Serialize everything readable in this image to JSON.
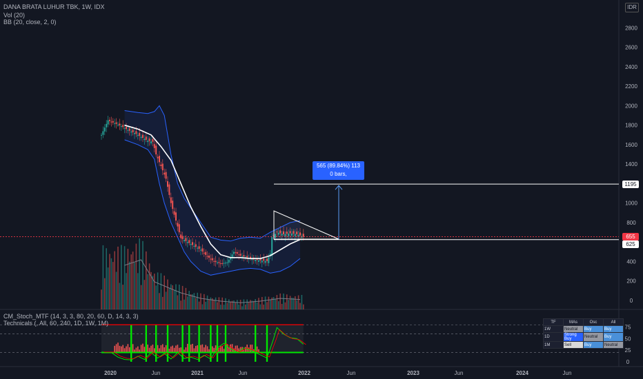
{
  "legend": {
    "main": "DANA BRATA LUHUR TBK, 1W, IDX",
    "volume": "Vol (20)",
    "bollinger": "BB (20, close, 2, 0)",
    "stoch": "CM_Stoch_MTF (14, 3, 3, 80, 20, 60, D, 14, 3, 3)",
    "technicals": "Technicals (, All, 60, 240, 1D, 1W, 1M)"
  },
  "currency": "IDR",
  "callout": {
    "line1": "565 (89.84%) 113",
    "line2": "0 bars,"
  },
  "price_tags": {
    "target": "1195",
    "last": "655",
    "support": "625"
  },
  "tech_table": {
    "headers": [
      "TF",
      "MAs",
      "Osc",
      "All"
    ],
    "rows": [
      {
        "tf": "1W",
        "mas": "Neutral",
        "osc": "Buy",
        "all": "Buy"
      },
      {
        "tf": "1D",
        "mas": "Strong Buy",
        "osc": "Neutral",
        "all": "Buy"
      },
      {
        "tf": "1M",
        "mas": "Sell",
        "osc": "Buy",
        "all": "Neutral"
      }
    ]
  },
  "colors": {
    "background": "#131722",
    "up": "#26a69a",
    "down": "#ef5350",
    "bb_band": "#2962ff",
    "basis": "#ffffff",
    "stoch_green": "#00e600",
    "stoch_red": "#ff0000",
    "stoch_grey": "#787b86"
  },
  "chart_data": {
    "type": "candlestick",
    "price_axis": {
      "ticks": [
        0,
        200,
        400,
        600,
        800,
        1000,
        1200,
        1400,
        1600,
        1800,
        2000,
        2200,
        2400,
        2600,
        2800
      ],
      "range": [
        0,
        2900
      ]
    },
    "stoch_axis": {
      "ticks": [
        0,
        25,
        50,
        75
      ],
      "range": [
        0,
        85
      ]
    },
    "time_axis": {
      "labels": [
        "2020",
        "Jun",
        "2021",
        "Jun",
        "2022",
        "Jun",
        "2023",
        "Jun",
        "2024",
        "Jun"
      ]
    },
    "levels": {
      "target": 1195,
      "last": 655,
      "support": 625
    },
    "measure": {
      "from": 630,
      "to": 1195,
      "change": 565,
      "percent": "89.84%"
    },
    "candle_path": [
      [
        0,
        1700
      ],
      [
        4,
        1850
      ],
      [
        8,
        1820
      ],
      [
        12,
        1790
      ],
      [
        16,
        1750
      ],
      [
        20,
        1720
      ],
      [
        24,
        1680
      ],
      [
        28,
        1640
      ],
      [
        31,
        1630
      ],
      [
        33,
        1500
      ],
      [
        36,
        1380
      ],
      [
        39,
        1250
      ],
      [
        42,
        1000
      ],
      [
        45,
        820
      ],
      [
        48,
        640
      ],
      [
        52,
        600
      ],
      [
        56,
        560
      ],
      [
        60,
        520
      ],
      [
        64,
        450
      ],
      [
        68,
        400
      ],
      [
        72,
        380
      ],
      [
        76,
        390
      ],
      [
        80,
        500
      ],
      [
        84,
        460
      ],
      [
        88,
        440
      ],
      [
        92,
        420
      ],
      [
        96,
        410
      ],
      [
        100,
        405
      ],
      [
        102,
        480
      ],
      [
        103,
        650
      ],
      [
        106,
        700
      ],
      [
        110,
        680
      ],
      [
        114,
        690
      ],
      [
        118,
        680
      ],
      [
        122,
        655
      ]
    ],
    "bollinger": {
      "basis": [
        [
          14,
          1800
        ],
        [
          22,
          1760
        ],
        [
          30,
          1700
        ],
        [
          36,
          1580
        ],
        [
          42,
          1440
        ],
        [
          48,
          1200
        ],
        [
          54,
          960
        ],
        [
          60,
          760
        ],
        [
          66,
          580
        ],
        [
          72,
          470
        ],
        [
          78,
          440
        ],
        [
          84,
          440
        ],
        [
          90,
          430
        ],
        [
          96,
          430
        ],
        [
          102,
          460
        ],
        [
          108,
          520
        ],
        [
          114,
          580
        ],
        [
          120,
          625
        ]
      ],
      "upper": [
        [
          14,
          1950
        ],
        [
          22,
          1930
        ],
        [
          28,
          1920
        ],
        [
          32,
          1940
        ],
        [
          35,
          2000
        ],
        [
          38,
          1900
        ],
        [
          42,
          1500
        ],
        [
          46,
          1200
        ],
        [
          50,
          1050
        ],
        [
          54,
          950
        ],
        [
          60,
          800
        ],
        [
          66,
          650
        ],
        [
          72,
          620
        ],
        [
          78,
          610
        ],
        [
          84,
          640
        ],
        [
          90,
          650
        ],
        [
          96,
          640
        ],
        [
          102,
          700
        ],
        [
          108,
          750
        ],
        [
          114,
          800
        ],
        [
          120,
          820
        ]
      ],
      "lower": [
        [
          14,
          1650
        ],
        [
          22,
          1600
        ],
        [
          28,
          1550
        ],
        [
          32,
          1450
        ],
        [
          35,
          1200
        ],
        [
          38,
          1000
        ],
        [
          42,
          800
        ],
        [
          46,
          650
        ],
        [
          50,
          500
        ],
        [
          54,
          400
        ],
        [
          60,
          300
        ],
        [
          66,
          260
        ],
        [
          72,
          280
        ],
        [
          78,
          300
        ],
        [
          84,
          320
        ],
        [
          90,
          330
        ],
        [
          96,
          320
        ],
        [
          102,
          280
        ],
        [
          108,
          300
        ],
        [
          114,
          350
        ],
        [
          120,
          430
        ]
      ]
    },
    "volume_ma": [
      [
        14,
        80
      ],
      [
        24,
        90
      ],
      [
        32,
        50
      ],
      [
        40,
        40
      ],
      [
        48,
        30
      ],
      [
        60,
        20
      ],
      [
        72,
        15
      ],
      [
        84,
        12
      ],
      [
        96,
        15
      ],
      [
        108,
        20
      ],
      [
        120,
        18
      ]
    ],
    "stoch_k": [
      [
        0,
        20
      ],
      [
        6,
        20
      ],
      [
        10,
        10
      ],
      [
        14,
        5
      ],
      [
        18,
        4
      ],
      [
        22,
        12
      ],
      [
        26,
        5
      ],
      [
        30,
        20
      ],
      [
        34,
        8
      ],
      [
        38,
        18
      ],
      [
        42,
        6
      ],
      [
        46,
        20
      ],
      [
        50,
        7
      ],
      [
        54,
        10
      ],
      [
        58,
        5
      ],
      [
        62,
        14
      ],
      [
        66,
        6
      ],
      [
        70,
        30
      ],
      [
        74,
        40
      ],
      [
        78,
        28
      ],
      [
        82,
        20
      ],
      [
        86,
        30
      ],
      [
        90,
        25
      ],
      [
        96,
        15
      ],
      [
        100,
        8
      ],
      [
        104,
        50
      ],
      [
        106,
        74
      ],
      [
        110,
        60
      ],
      [
        114,
        52
      ],
      [
        118,
        50
      ],
      [
        122,
        38
      ]
    ],
    "stoch_bars": [
      [
        8,
        38
      ],
      [
        12,
        33
      ],
      [
        16,
        35
      ],
      [
        20,
        30
      ],
      [
        24,
        36
      ],
      [
        28,
        34
      ],
      [
        32,
        33
      ],
      [
        36,
        35
      ],
      [
        40,
        32
      ],
      [
        44,
        34
      ],
      [
        48,
        30
      ],
      [
        52,
        36
      ],
      [
        56,
        33
      ],
      [
        60,
        35
      ],
      [
        64,
        31
      ],
      [
        68,
        34
      ],
      [
        72,
        32
      ],
      [
        76,
        36
      ],
      [
        80,
        33
      ],
      [
        84,
        30
      ],
      [
        88,
        35
      ],
      [
        92,
        31
      ]
    ],
    "stoch_signals": [
      18,
      27,
      33,
      40,
      49,
      53,
      59,
      66,
      70,
      75,
      93,
      100
    ]
  }
}
